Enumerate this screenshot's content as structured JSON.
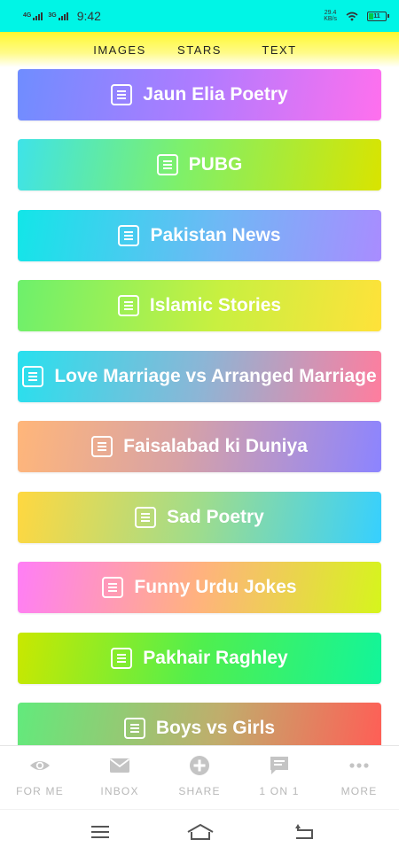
{
  "status_bar": {
    "network_1": "4G",
    "network_2": "3G",
    "time": "9:42",
    "speed_value": "29.4",
    "speed_unit": "KB/s",
    "battery": "11"
  },
  "top_tabs": [
    {
      "label": "IMAGES"
    },
    {
      "label": "STARS"
    },
    {
      "label": "TEXT"
    }
  ],
  "categories": [
    {
      "label": "Jaun Elia Poetry",
      "icon": "document-icon"
    },
    {
      "label": "PUBG",
      "icon": "document-icon"
    },
    {
      "label": "Pakistan News",
      "icon": "document-icon"
    },
    {
      "label": "Islamic Stories",
      "icon": "document-icon"
    },
    {
      "label": "Love Marriage vs Arranged Marriage",
      "icon": "document-icon"
    },
    {
      "label": "Faisalabad ki Duniya",
      "icon": "document-icon"
    },
    {
      "label": "Sad Poetry",
      "icon": "document-icon"
    },
    {
      "label": "Funny Urdu Jokes",
      "icon": "document-icon"
    },
    {
      "label": "Pakhair Raghley",
      "icon": "document-icon"
    },
    {
      "label": "Boys vs Girls",
      "icon": "document-icon"
    }
  ],
  "bottom_nav": [
    {
      "label": "FOR ME",
      "icon": "eye-icon"
    },
    {
      "label": "INBOX",
      "icon": "mail-icon"
    },
    {
      "label": "SHARE",
      "icon": "plus-circle-icon"
    },
    {
      "label": "1 ON 1",
      "icon": "chat-icon"
    },
    {
      "label": "MORE",
      "icon": "more-dots-icon"
    }
  ],
  "colors": {
    "status_bar": "#00f5e6",
    "tab_bar": "#fff82e",
    "nav_inactive": "#b8b8b8"
  }
}
